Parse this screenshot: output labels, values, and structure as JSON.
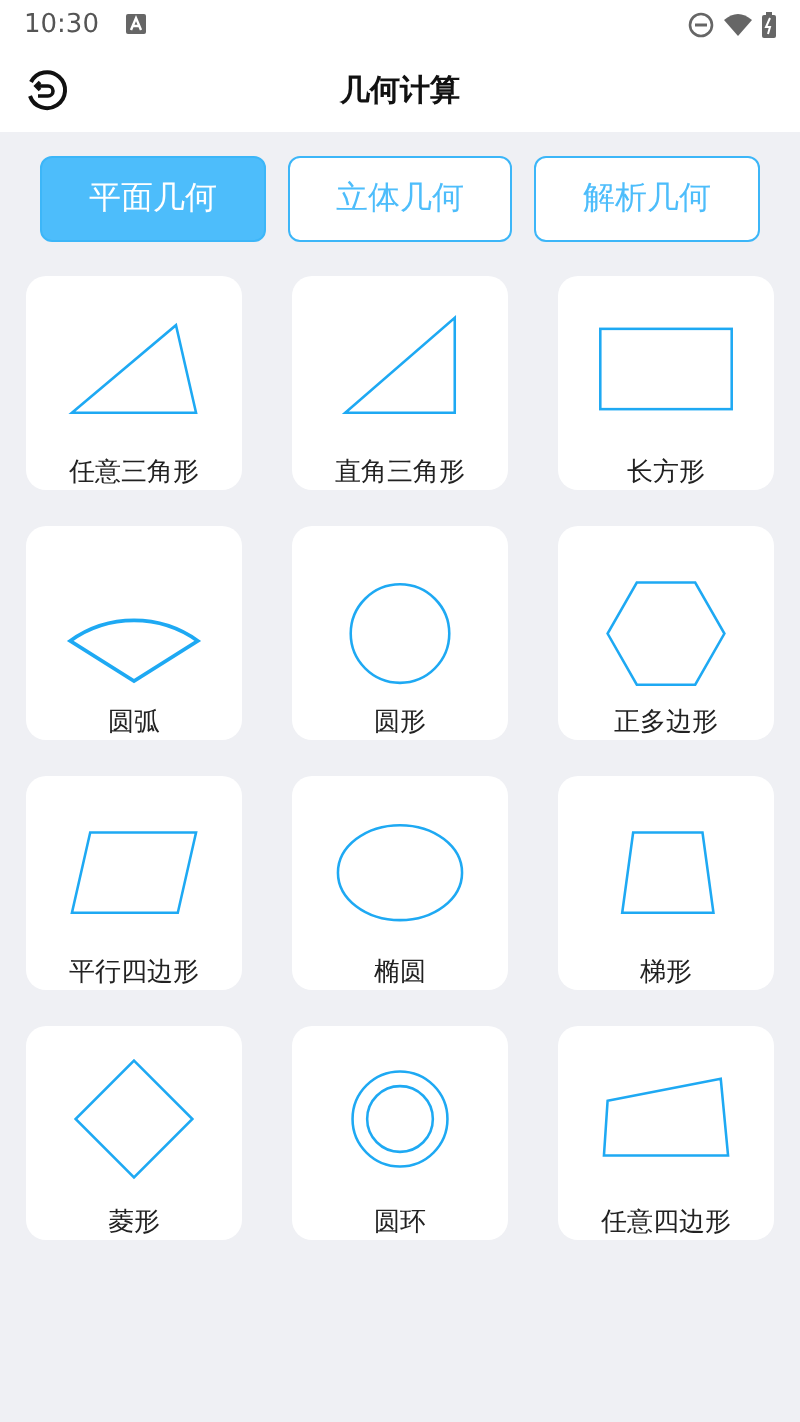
{
  "status_bar": {
    "time": "10:30"
  },
  "header": {
    "title": "几何计算"
  },
  "tabs": [
    {
      "label": "平面几何",
      "selected": true
    },
    {
      "label": "立体几何",
      "selected": false
    },
    {
      "label": "解析几何",
      "selected": false
    }
  ],
  "shapes": [
    {
      "label": "任意三角形",
      "kind": "triangle"
    },
    {
      "label": "直角三角形",
      "kind": "right-triangle"
    },
    {
      "label": "长方形",
      "kind": "rectangle"
    },
    {
      "label": "圆弧",
      "kind": "sector"
    },
    {
      "label": "圆形",
      "kind": "circle"
    },
    {
      "label": "正多边形",
      "kind": "hexagon"
    },
    {
      "label": "平行四边形",
      "kind": "parallelogram"
    },
    {
      "label": "椭圆",
      "kind": "ellipse"
    },
    {
      "label": "梯形",
      "kind": "trapezoid"
    },
    {
      "label": "菱形",
      "kind": "rhombus"
    },
    {
      "label": "圆环",
      "kind": "ring"
    },
    {
      "label": "任意四边形",
      "kind": "quadrilateral"
    }
  ]
}
